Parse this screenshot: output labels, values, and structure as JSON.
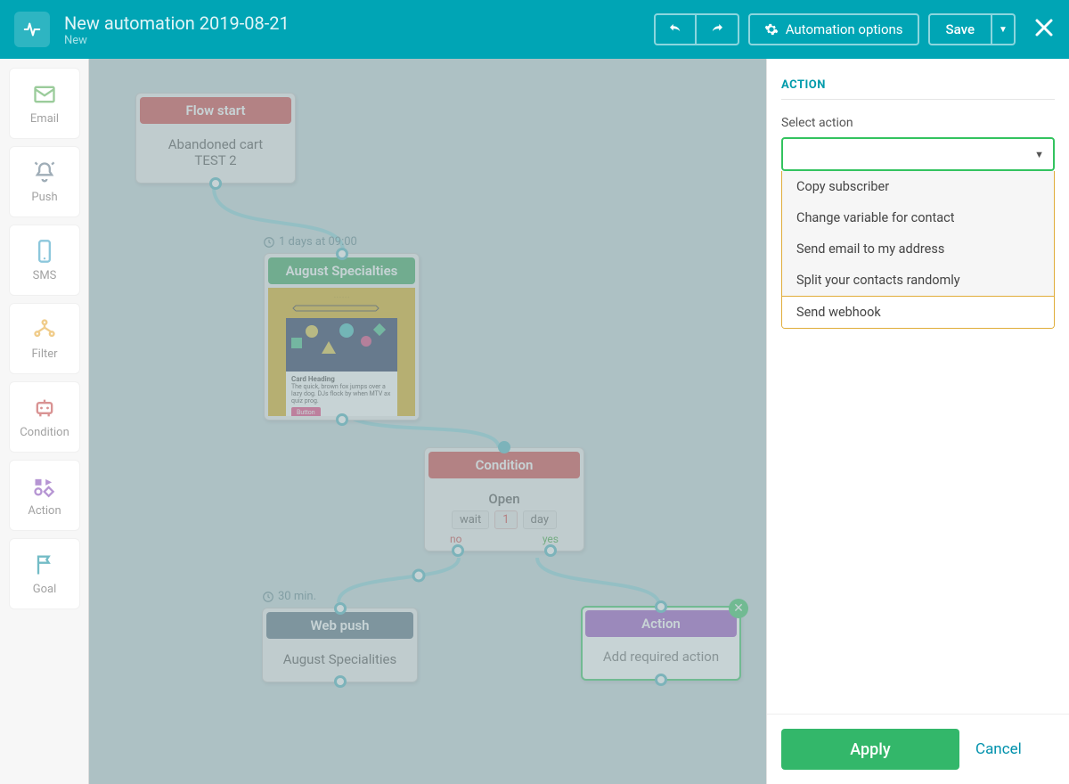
{
  "header": {
    "title": "New automation 2019-08-21",
    "status": "New",
    "options_label": "Automation options",
    "save_label": "Save"
  },
  "rail": {
    "items": [
      {
        "label": "Email",
        "icon": "email-icon",
        "color": "#49a24a"
      },
      {
        "label": "Push",
        "icon": "bell-icon",
        "color": "#516b7d"
      },
      {
        "label": "SMS",
        "icon": "phone-icon",
        "color": "#2f9abf"
      },
      {
        "label": "Filter",
        "icon": "filter-icon",
        "color": "#e3a22b"
      },
      {
        "label": "Condition",
        "icon": "robot-icon",
        "color": "#ba3b3b"
      },
      {
        "label": "Action",
        "icon": "action-icon",
        "color": "#7b3fb0"
      },
      {
        "label": "Goal",
        "icon": "flag-icon",
        "color": "#008698"
      }
    ]
  },
  "nodes": {
    "flow_start": {
      "title": "Flow start",
      "body": "Abandoned cart\nTEST 2"
    },
    "timer1": "1 days at 09:00",
    "email": {
      "title": "August Specialties",
      "card_heading": "Card Heading",
      "card_text": "The quick, brown fox jumps over a lazy dog. DJs flock by when MTV ax quiz prog.",
      "button": "Button"
    },
    "condition": {
      "title": "Condition",
      "subtitle": "Open",
      "wait_label": "wait",
      "wait_value": "1",
      "unit": "day",
      "no": "no",
      "yes": "yes"
    },
    "timer2": "30 min.",
    "webpush": {
      "title": "Web push",
      "body": "August Specialities"
    },
    "action": {
      "title": "Action",
      "body": "Add required action"
    }
  },
  "panel": {
    "section_title": "Action",
    "select_label": "Select action",
    "options": [
      "Copy subscriber",
      "Change variable for contact",
      "Send email to my address",
      "Split your contacts randomly",
      "Send webhook"
    ],
    "apply": "Apply",
    "cancel": "Cancel"
  }
}
